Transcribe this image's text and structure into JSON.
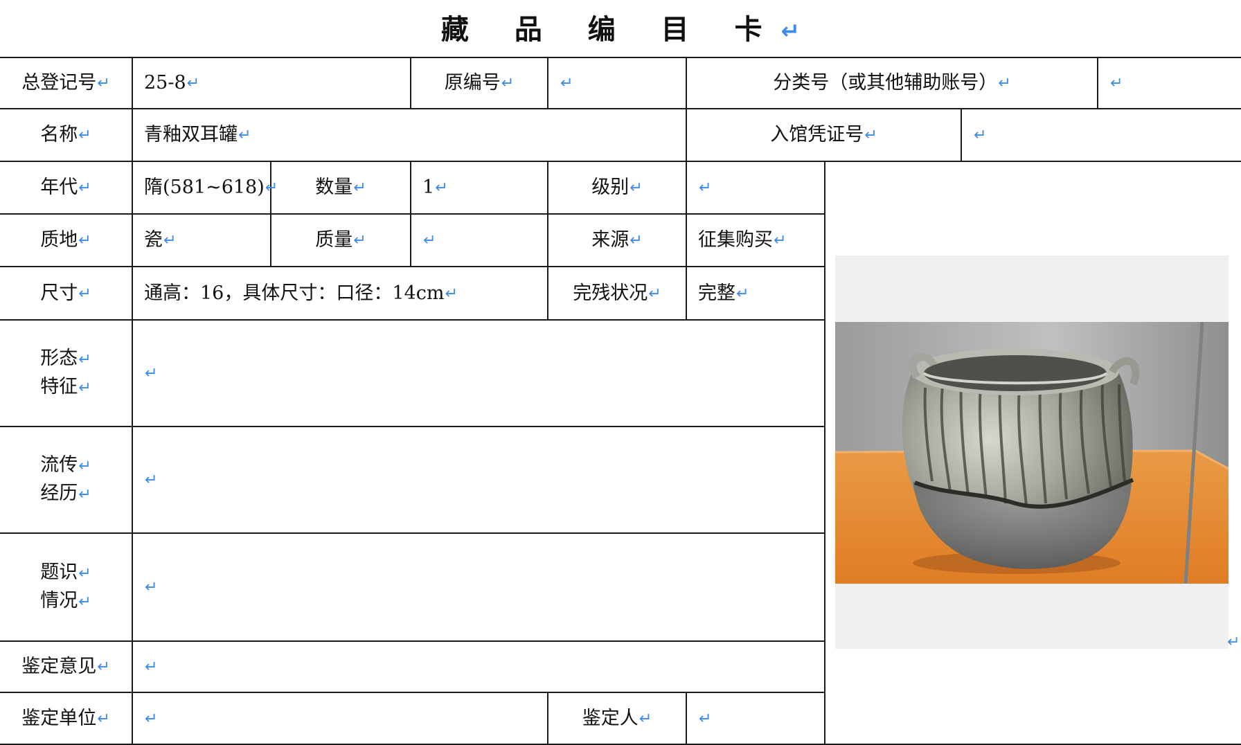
{
  "title": "藏 品 编 目 卡",
  "return_mark": "↵",
  "fields": {
    "reg_no_label": "总登记号",
    "reg_no_value": "25-8",
    "orig_no_label": "原编号",
    "orig_no_value": "",
    "class_no_label": "分类号（或其他辅助账号）",
    "class_no_value": "",
    "name_label": "名称",
    "name_value": "青釉双耳罐",
    "voucher_label": "入馆凭证号",
    "voucher_value": "",
    "era_label": "年代",
    "era_value": "隋(581~618)",
    "qty_label": "数量",
    "qty_value": "1",
    "level_label": "级别",
    "level_value": "",
    "material_label": "质地",
    "material_value": "瓷",
    "mass_label": "质量",
    "mass_value": "",
    "source_label": "来源",
    "source_value": "征集购买",
    "size_label": "尺寸",
    "size_value": "通高：16，具体尺寸：口径：14cm",
    "condition_label": "完残状况",
    "condition_value": "完整",
    "form_label_1": "形态",
    "form_label_2": "特征",
    "form_value": "",
    "history_label_1": "流传",
    "history_label_2": "经历",
    "history_value": "",
    "inscription_label_1": "题识",
    "inscription_label_2": "情况",
    "inscription_value": "",
    "opinion_label": "鉴定意见",
    "opinion_value": "",
    "unit_label": "鉴定单位",
    "unit_value": "",
    "appraiser_label": "鉴定人",
    "appraiser_value": ""
  },
  "colors": {
    "return_mark": "#3b8be8",
    "border": "#1a1a1a",
    "photo_frame": "#efefef"
  }
}
